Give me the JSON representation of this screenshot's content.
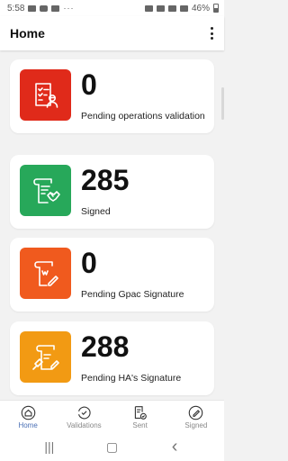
{
  "status_bar": {
    "time": "5:58",
    "dots": "···",
    "battery": "46%"
  },
  "app_bar": {
    "title": "Home"
  },
  "cards": [
    {
      "count": "0",
      "label": "Pending operations validation",
      "color": "#e02a1a",
      "icon": "user-checklist-icon"
    },
    {
      "count": "285",
      "label": "Signed",
      "color": "#27a85a",
      "icon": "signed-document-icon"
    },
    {
      "count": "0",
      "label": "Pending Gpac Signature",
      "color": "#f05a1e",
      "icon": "document-pen-icon"
    },
    {
      "count": "288",
      "label": "Pending HA's Signature",
      "color": "#f29a13",
      "icon": "gavel-document-icon"
    }
  ],
  "bottom_nav": [
    {
      "label": "Home",
      "icon": "home-icon",
      "active": true
    },
    {
      "label": "Validations",
      "icon": "validations-icon",
      "active": false
    },
    {
      "label": "Sent",
      "icon": "sent-document-icon",
      "active": false
    },
    {
      "label": "Signed",
      "icon": "signed-pen-icon",
      "active": false
    }
  ],
  "system_nav": {
    "recents": "|||",
    "home": "▢",
    "back": "‹"
  },
  "colors": {
    "accent": "#4a6fb5",
    "background": "#f2f2f2"
  }
}
